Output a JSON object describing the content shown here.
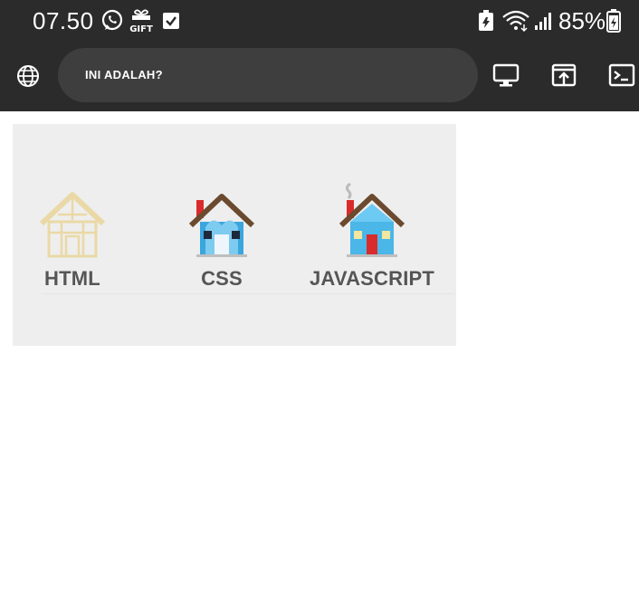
{
  "status_bar": {
    "time": "07.50",
    "battery_percent": "85%",
    "icons": [
      "whatsapp-icon",
      "gift-icon",
      "checkbox-icon",
      "battery-saver-icon",
      "wifi-icon",
      "signal-icon",
      "battery-icon"
    ]
  },
  "browser": {
    "url_text": "INI ADALAH?",
    "icons": [
      "globe-icon",
      "desktop-icon",
      "open-tab-icon",
      "terminal-icon"
    ]
  },
  "tabs": [
    {
      "label": "HTML",
      "icon": "house-frame-icon"
    },
    {
      "label": "CSS",
      "icon": "house-blue-icon"
    },
    {
      "label": "JAVASCRIPT",
      "icon": "house-chimney-smoke-icon"
    }
  ],
  "colors": {
    "bar_bg": "#2b2b2b",
    "urlbar_bg": "#3e3e3e",
    "panel_bg": "#eeeeee",
    "label": "#555555",
    "roof": "#6b4a2f",
    "wall_blue": "#3aa6de",
    "frame": "#ead9a6"
  }
}
